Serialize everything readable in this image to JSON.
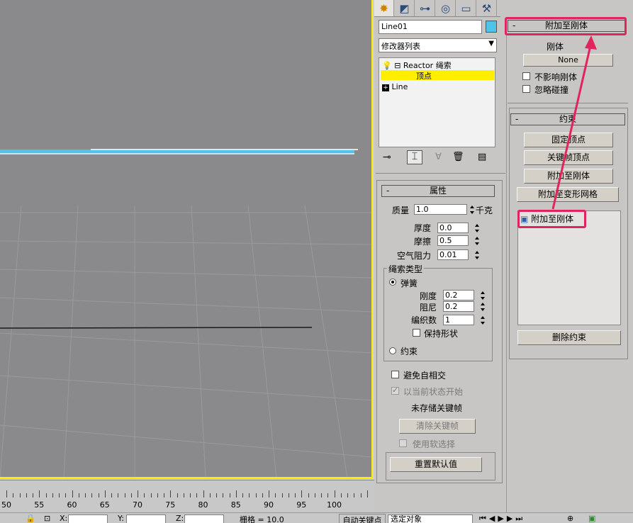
{
  "object_name": "Line01",
  "object_color": "#4fc3e8",
  "modifier_dropdown": "修改器列表",
  "modifier_stack": {
    "items": [
      {
        "label": "Reactor 绳索",
        "expander": "⊟"
      },
      {
        "label": "顶点",
        "selected": true
      },
      {
        "label": "Line",
        "expander": "⊞"
      }
    ]
  },
  "properties": {
    "header": "属性",
    "mass_label": "质量",
    "mass_value": "1.0",
    "mass_unit": "千克",
    "thickness_label": "厚度",
    "thickness_value": "0.0",
    "friction_label": "摩擦",
    "friction_value": "0.5",
    "air_label": "空气阻力",
    "air_value": "0.01",
    "rope_type_label": "绳索类型",
    "spring_label": "弹簧",
    "stiffness_label": "刚度",
    "stiffness_value": "0.2",
    "damping_label": "阻尼",
    "damping_value": "0.2",
    "weave_label": "编织数",
    "weave_value": "1",
    "keep_shape_label": "保持形状",
    "constraint_label": "约束",
    "avoid_self_label": "避免自相交",
    "start_current_label": "以当前状态开始",
    "no_keyframe_label": "未存储关键帧",
    "clear_keys_button": "清除关键帧",
    "use_soft_label": "使用软选择",
    "reset_button": "重置默认值"
  },
  "attach_rollout": {
    "header": "附加至刚体",
    "rigid_label": "刚体",
    "none_button": "None",
    "no_affect_label": "不影响刚体",
    "ignore_collision_label": "忽略碰撞"
  },
  "constraints": {
    "header": "约束",
    "fix_vertex": "固定顶点",
    "keyframe_vertex": "关键帧顶点",
    "attach_rigid": "附加至刚体",
    "attach_deform": "附加至变形网格",
    "list_item": "附加至刚体",
    "delete_button": "删除约束"
  },
  "timeline": {
    "labels": [
      "50",
      "55",
      "60",
      "65",
      "70",
      "75",
      "80",
      "85",
      "90",
      "95",
      "100"
    ]
  },
  "statusbar": {
    "x_label": "X:",
    "y_label": "Y:",
    "z_label": "Z:",
    "grid_label": "栅格 = 10.0",
    "auto_key_label": "自动关键点",
    "selection_dropdown": "选定对象"
  },
  "colors": {
    "accent_yellow": "#ffee00",
    "highlight_red": "#e0245e",
    "selected_row": "#ffee00"
  }
}
